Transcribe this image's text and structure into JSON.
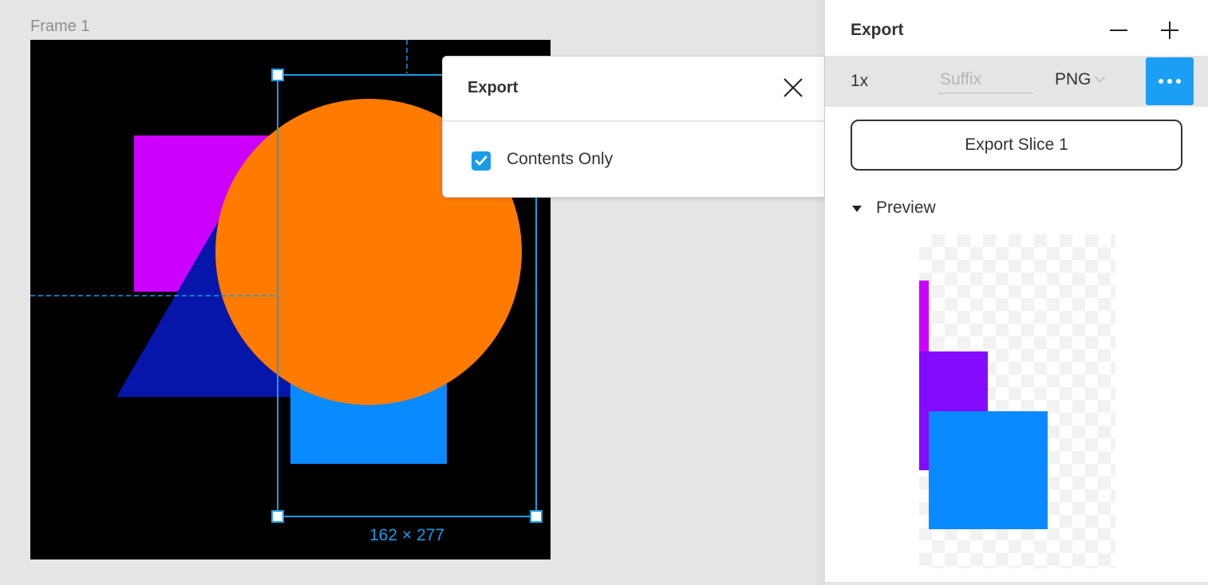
{
  "canvas": {
    "frame_label": "Frame 1",
    "selection_dimensions": "162 × 277",
    "shapes": [
      {
        "name": "rectangle-magenta",
        "color": "#cc00ff"
      },
      {
        "name": "triangle-navy",
        "color": "#0616aa"
      },
      {
        "name": "rectangle-blue",
        "color": "#0a8aff"
      },
      {
        "name": "ellipse-orange",
        "color": "#ff7b00"
      }
    ],
    "selection_color": "#1a9be8"
  },
  "export_popover": {
    "title": "Export",
    "close_icon": "close-icon",
    "options": [
      {
        "label": "Contents Only",
        "checked": true
      }
    ]
  },
  "panel": {
    "title": "Export",
    "remove_icon": "minus-icon",
    "add_icon": "plus-icon",
    "export_setting": {
      "scale": "1x",
      "suffix_value": "",
      "suffix_placeholder": "Suffix",
      "format": "PNG",
      "more_icon": "ellipsis-icon"
    },
    "export_button_label": "Export Slice 1",
    "preview": {
      "label": "Preview",
      "expanded": true,
      "colors": {
        "magenta": "#cc00ff",
        "purple": "#850bff",
        "blue": "#0a8aff"
      }
    }
  },
  "colors": {
    "accent": "#1a9ff5",
    "canvas_bg": "#e5e5e5"
  }
}
